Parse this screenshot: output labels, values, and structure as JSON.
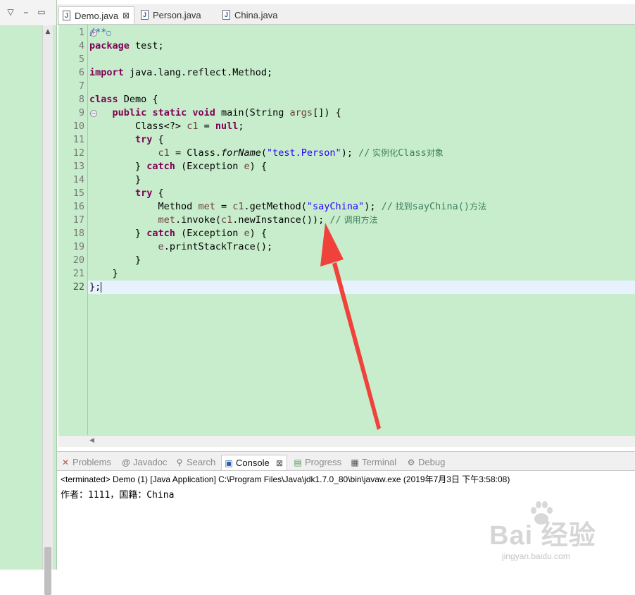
{
  "editor_tabs": [
    {
      "label": "Demo.java",
      "active": true,
      "close": "⊠"
    },
    {
      "label": "Person.java",
      "active": false
    },
    {
      "label": "China.java",
      "active": false
    }
  ],
  "icons": {
    "java_file": "J",
    "minimize": "⎯",
    "maximize": "▭",
    "view_menu": "▽"
  },
  "code_lines": [
    {
      "n": "1",
      "text": "/**▢"
    },
    {
      "n": "4",
      "text": "package test;"
    },
    {
      "n": "5",
      "text": ""
    },
    {
      "n": "6",
      "text": "import java.lang.reflect.Method;"
    },
    {
      "n": "7",
      "text": ""
    },
    {
      "n": "8",
      "text": "class Demo {"
    },
    {
      "n": "9",
      "text": "    public static void main(String args[]) {"
    },
    {
      "n": "10",
      "text": "        Class<?> c1 = null;"
    },
    {
      "n": "11",
      "text": "        try {"
    },
    {
      "n": "12",
      "text": "            c1 = Class.forName(\"test.Person\"); // 实例化Class对象"
    },
    {
      "n": "13",
      "text": "        } catch (Exception e) {"
    },
    {
      "n": "14",
      "text": "        }"
    },
    {
      "n": "15",
      "text": "        try {"
    },
    {
      "n": "16",
      "text": "            Method met = c1.getMethod(\"sayChina\"); // 找到sayChina()方法"
    },
    {
      "n": "17",
      "text": "            met.invoke(c1.newInstance()); // 调用方法"
    },
    {
      "n": "18",
      "text": "        } catch (Exception e) {"
    },
    {
      "n": "19",
      "text": "            e.printStackTrace();"
    },
    {
      "n": "20",
      "text": "        }"
    },
    {
      "n": "21",
      "text": "    }"
    },
    {
      "n": "22",
      "text": "};"
    }
  ],
  "tokens": {
    "jd_open": "/**",
    "jd_fold": "▢",
    "package": "package",
    "test": " test;",
    "import": "import",
    "import_path": " java.lang.reflect.Method;",
    "class": "class",
    "demo": " Demo {",
    "public": "public",
    "static": "static",
    "void": "void",
    "main_sig": " main(String ",
    "args": "args",
    "main_end": "[]) {",
    "class_generic": "Class<?> ",
    "c1": "c1",
    "eq": " = ",
    "null": "null",
    "semi": ";",
    "try": "try",
    "brace_open": " {",
    "assign": " = Class.",
    "forName": "forName",
    "lparen": "(",
    "str_person": "\"test.Person\"",
    "rparen_semi": "); ",
    "cm_slashes": "//",
    "cm_instantiate_cn": " 实例化",
    "cm_class": "Class",
    "cm_obj_cn": "对象",
    "close_brace": "} ",
    "catch": "catch",
    "exception": " (Exception ",
    "e": "e",
    "catch_end": ") {",
    "brace": "}",
    "method": "Method ",
    "met": "met",
    "getmethod": ".getMethod(",
    "str_say": "\"sayChina\"",
    "cm_find_cn": " 找到",
    "cm_saychina": "sayChina()",
    "cm_method_cn": "方法",
    "invoke": ".invoke(",
    "newinst": ".newInstance()",
    "invoke_end": "); ",
    "cm_call_cn": " 调用方法",
    "pst": ".printStackTrace();",
    "end": "};"
  },
  "bottom_tabs": [
    {
      "label": "Problems",
      "icon": "✕"
    },
    {
      "label": "Javadoc",
      "icon": "@"
    },
    {
      "label": "Search",
      "icon": "⚲"
    },
    {
      "label": "Console",
      "icon": "▣",
      "active": true,
      "close": "⊠"
    },
    {
      "label": "Progress",
      "icon": "▤"
    },
    {
      "label": "Terminal",
      "icon": "▦"
    },
    {
      "label": "Debug",
      "icon": "⚙"
    }
  ],
  "console": {
    "status": "<terminated> Demo (1) [Java Application] C:\\Program Files\\Java\\jdk1.7.0_80\\bin\\javaw.exe (2019年7月3日 下午3:58:08)",
    "output": "作者：1111，国籍：China"
  },
  "watermark": {
    "brand": "Bai  经验",
    "url": "jingyan.baidu.com"
  },
  "colors": {
    "editor_bg": "#c7edcc",
    "keyword": "#7f0055",
    "comment": "#3f7f5f",
    "string": "#2a00ff",
    "javadoc": "#3f5fbf",
    "annotation_arrow": "#f0413a"
  }
}
